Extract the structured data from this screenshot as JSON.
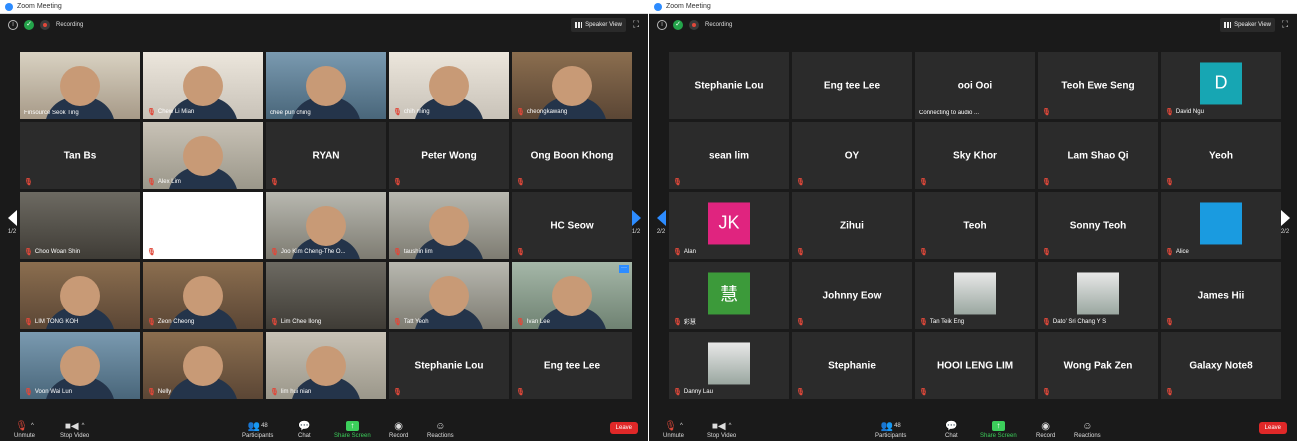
{
  "left_window": {
    "title": "Zoom Meeting",
    "recording_label": "Recording",
    "speaker_view_label": "Speaker View",
    "prev_page": "1/2",
    "next_page": "1/2",
    "tiles": [
      {
        "name": "Finsource Seok Ting",
        "muted": false,
        "kind": "video",
        "bg": "bg-a",
        "active": true
      },
      {
        "name": "Chew Li Mian",
        "muted": true,
        "kind": "video",
        "bg": "bg-d"
      },
      {
        "name": "chee pun ching",
        "muted": false,
        "kind": "video",
        "bg": "bg-c"
      },
      {
        "name": "chih ming",
        "muted": true,
        "kind": "video",
        "bg": "bg-d"
      },
      {
        "name": "cheongkawang",
        "muted": true,
        "kind": "video",
        "bg": "bg-e"
      },
      {
        "name": "Tan Bs",
        "muted": true,
        "kind": "name"
      },
      {
        "name": "Alex Lim",
        "muted": true,
        "kind": "video",
        "bg": "bg-b"
      },
      {
        "name": "RYAN",
        "muted": true,
        "kind": "name"
      },
      {
        "name": "Peter Wong",
        "muted": true,
        "kind": "name"
      },
      {
        "name": "Ong Boon Khong",
        "muted": true,
        "kind": "name"
      },
      {
        "name": "Choo Woan Shin",
        "muted": true,
        "kind": "video",
        "bg": "bg-g"
      },
      {
        "name": "Queenie Goh",
        "muted": true,
        "kind": "video",
        "bg": "bg-i"
      },
      {
        "name": "Joo Kim Cheng-The O...",
        "muted": true,
        "kind": "video",
        "bg": "bg-f"
      },
      {
        "name": "taushin lim",
        "muted": true,
        "kind": "video",
        "bg": "bg-f"
      },
      {
        "name": "HC Seow",
        "muted": true,
        "kind": "name"
      },
      {
        "name": "LIM TONG KOH",
        "muted": true,
        "kind": "video",
        "bg": "bg-e"
      },
      {
        "name": "Zeon Cheong",
        "muted": true,
        "kind": "video",
        "bg": "bg-e"
      },
      {
        "name": "Lim Chee Ilong",
        "muted": true,
        "kind": "video",
        "bg": "bg-g"
      },
      {
        "name": "Tatt Yeoh",
        "muted": true,
        "kind": "video",
        "bg": "bg-f"
      },
      {
        "name": "Ivan Lee",
        "muted": true,
        "kind": "video",
        "bg": "bg-h"
      },
      {
        "name": "Voon Wai Lun",
        "muted": true,
        "kind": "video",
        "bg": "bg-c"
      },
      {
        "name": "Nelly",
        "muted": true,
        "kind": "video",
        "bg": "bg-e"
      },
      {
        "name": "lim hui nian",
        "muted": true,
        "kind": "video",
        "bg": "bg-b"
      },
      {
        "name": "Stephanie Lou",
        "muted": true,
        "kind": "name"
      },
      {
        "name": "Eng tee Lee",
        "muted": true,
        "kind": "name"
      }
    ],
    "toolbar": {
      "unmute": "Unmute",
      "stop_video": "Stop Video",
      "participants": "Participants",
      "participant_count": "48",
      "chat": "Chat",
      "share_screen": "Share Screen",
      "record": "Record",
      "reactions": "Reactions",
      "leave": "Leave"
    }
  },
  "right_window": {
    "title": "Zoom Meeting",
    "recording_label": "Recording",
    "speaker_view_label": "Speaker View",
    "prev_page": "2/2",
    "next_page": "2/2",
    "tiles": [
      {
        "name": "Stephanie Lou",
        "muted": false,
        "kind": "name"
      },
      {
        "name": "Eng tee Lee",
        "muted": false,
        "kind": "name"
      },
      {
        "name": "ooi Ooi",
        "muted": false,
        "kind": "name",
        "caption": "Connecting to audio ..."
      },
      {
        "name": "Teoh Ewe Seng",
        "muted": true,
        "kind": "name"
      },
      {
        "name": "David Ngu",
        "muted": true,
        "kind": "letter",
        "letter": "D",
        "color": "#17a6b3"
      },
      {
        "name": "sean lim",
        "muted": true,
        "kind": "name"
      },
      {
        "name": "OY",
        "muted": true,
        "kind": "name"
      },
      {
        "name": "Sky Khor",
        "muted": true,
        "kind": "name"
      },
      {
        "name": "Lam Shao Qi",
        "muted": true,
        "kind": "name"
      },
      {
        "name": "Yeoh",
        "muted": true,
        "kind": "name"
      },
      {
        "name": "Alan",
        "muted": true,
        "kind": "letter",
        "letter": "JK",
        "color": "#e0247f"
      },
      {
        "name": "Zihui",
        "muted": true,
        "kind": "name"
      },
      {
        "name": "Teoh",
        "muted": true,
        "kind": "name"
      },
      {
        "name": "Sonny Teoh",
        "muted": true,
        "kind": "name"
      },
      {
        "name": "Alice",
        "muted": true,
        "kind": "letter",
        "letter": "",
        "color": "#1a9be0"
      },
      {
        "name": "彩慧",
        "muted": true,
        "kind": "letter",
        "letter": "慧",
        "color": "#3c9a3a"
      },
      {
        "name": "Johnny Eow",
        "muted": true,
        "kind": "name"
      },
      {
        "name": "Tan Teik Eng",
        "muted": true,
        "kind": "photo"
      },
      {
        "name": "Dato' Sri Chang Y S",
        "muted": true,
        "kind": "photo"
      },
      {
        "name": "James Hii",
        "muted": true,
        "kind": "name"
      },
      {
        "name": "Danny Lau",
        "muted": true,
        "kind": "photo"
      },
      {
        "name": "Stephanie",
        "muted": true,
        "kind": "name"
      },
      {
        "name": "HOOI LENG LIM",
        "muted": true,
        "kind": "name"
      },
      {
        "name": "Wong Pak Zen",
        "muted": true,
        "kind": "name"
      },
      {
        "name": "Galaxy Note8",
        "muted": true,
        "kind": "name"
      }
    ],
    "toolbar": {
      "unmute": "Unmute",
      "stop_video": "Stop Video",
      "participants": "Participants",
      "participant_count": "48",
      "chat": "Chat",
      "share_screen": "Share Screen",
      "record": "Record",
      "reactions": "Reactions",
      "leave": "Leave"
    }
  },
  "colors": {
    "background": "#1a1a1a",
    "tile": "#2b2b2b",
    "active_speaker": "#b5d94c",
    "leave": "#e02828",
    "share": "#3ccf5b",
    "accent": "#2d8cff",
    "muted_icon": "#e0483a"
  }
}
